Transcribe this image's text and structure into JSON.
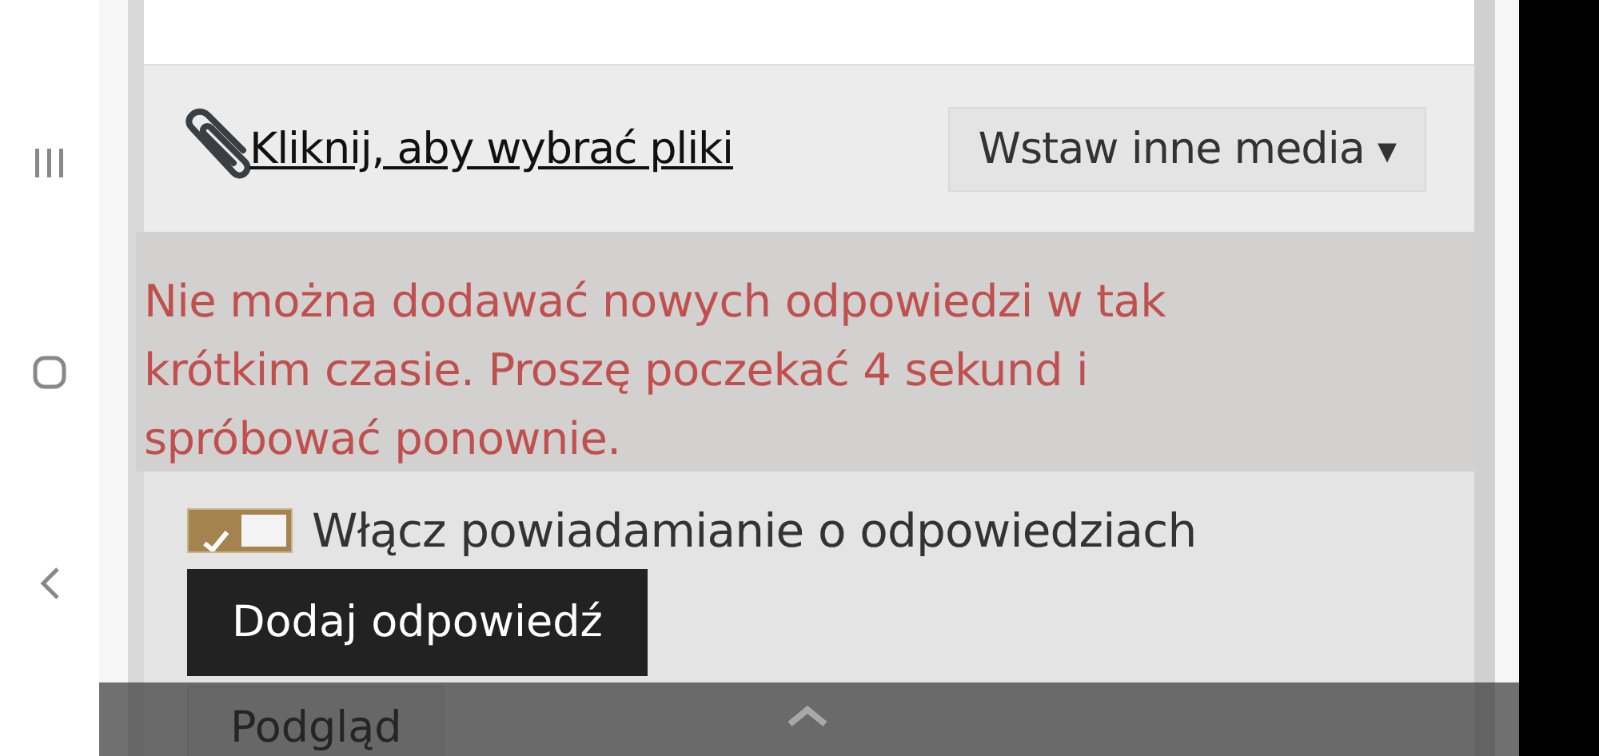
{
  "toolbar": {
    "attach_link": "Kliknij, aby wybrać pliki",
    "media_button": "Wstaw inne media",
    "media_caret": "▾"
  },
  "error": "Nie można dodawać nowych odpowiedzi w tak krótkim czasie. Proszę poczekać 4 sekund i spróbować ponownie.",
  "notify_toggle": {
    "label": "Włącz powiadamianie o odpowiedziach",
    "checked": true
  },
  "buttons": [
    {
      "label": "Dodaj odpowiedź",
      "kind": "primary"
    },
    {
      "label": "Podgląd",
      "kind": "secondary"
    }
  ]
}
